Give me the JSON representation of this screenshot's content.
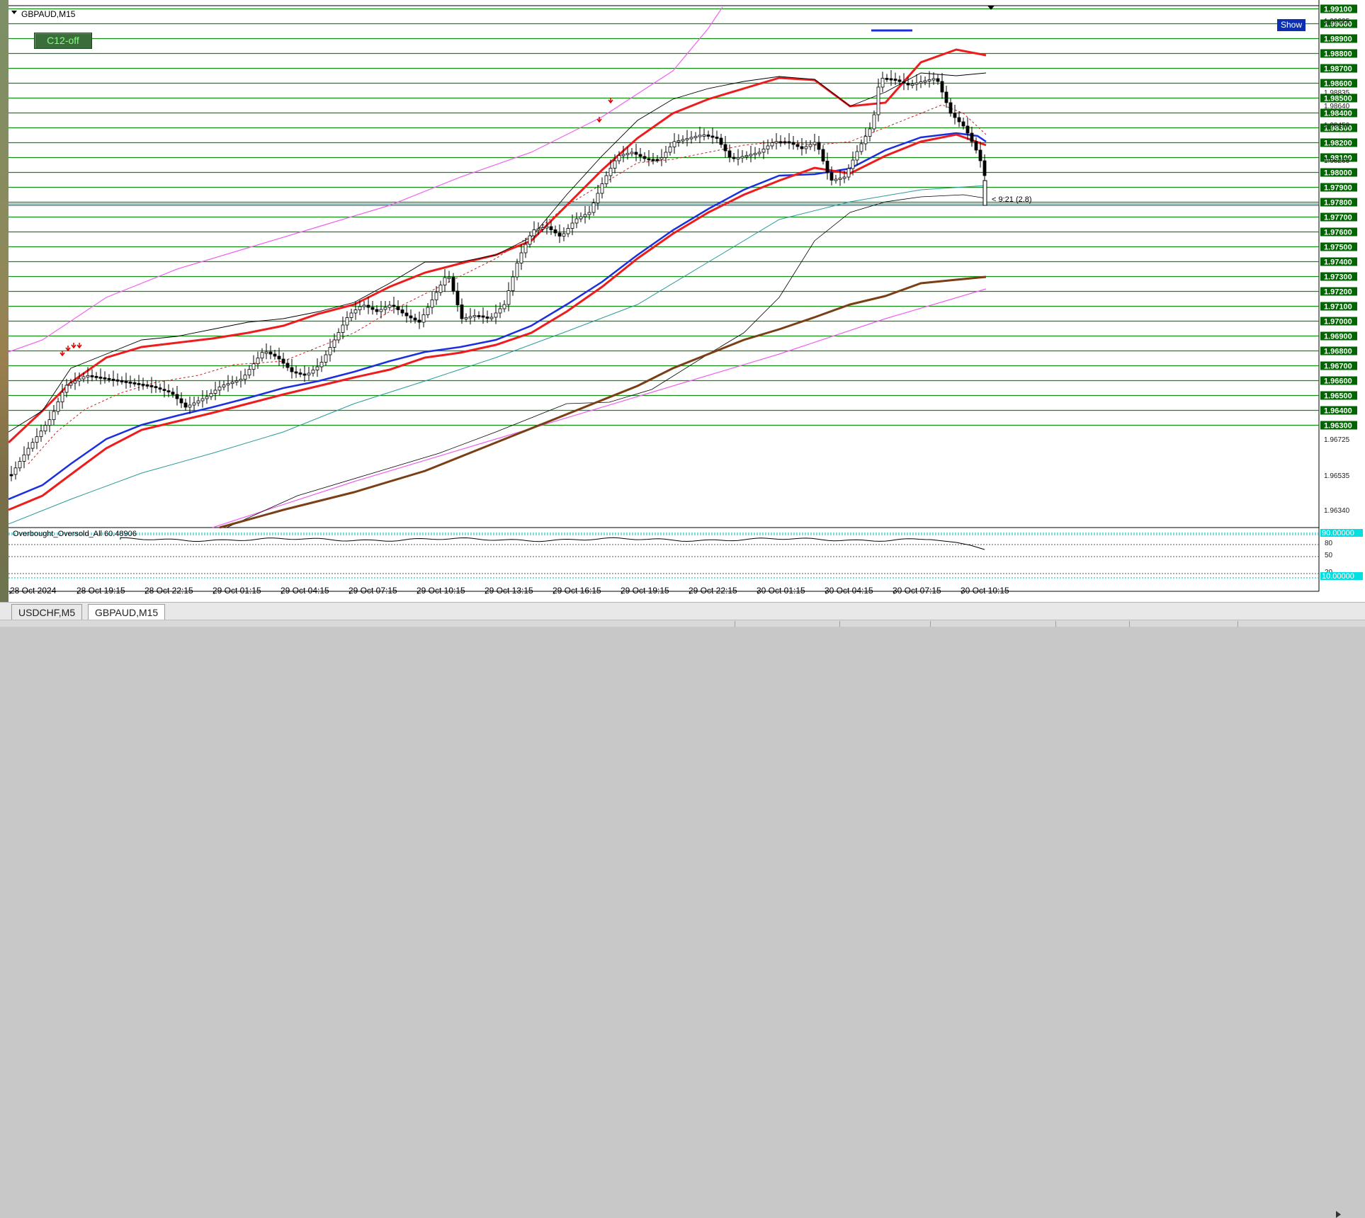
{
  "chart": {
    "symbol_label": "GBPAUD,M15",
    "indicator_button": "C12-off",
    "show_button": "Show",
    "timer_label": "< 9:21 (2.8)",
    "oscillator_label": "Overbought_Oversold_All 60.48906"
  },
  "price_axis": {
    "level_labels": [
      "1.99100",
      "1.99000",
      "1.98900",
      "1.98800",
      "1.98700",
      "1.98600",
      "1.98500",
      "1.98400",
      "1.98300",
      "1.98200",
      "1.98100",
      "1.98000",
      "1.97900",
      "1.97800",
      "1.97700",
      "1.97600",
      "1.97500",
      "1.97400",
      "1.97300",
      "1.97200",
      "1.97100",
      "1.97000",
      "1.96900",
      "1.96800",
      "1.96700",
      "1.96600",
      "1.96500",
      "1.96400",
      "1.96300"
    ],
    "minor_labels": [
      "1.99025",
      "1.98835",
      "1.98640",
      "1.98450",
      "1.98260",
      "1.96725",
      "1.96535",
      "1.96340"
    ],
    "oscillator_labels": [
      "90.00000",
      "80",
      "50",
      "20",
      "10.00000"
    ]
  },
  "time_axis": {
    "labels": [
      "28 Oct 2024",
      "28 Oct 19:15",
      "28 Oct 22:15",
      "29 Oct 01:15",
      "29 Oct 04:15",
      "29 Oct 07:15",
      "29 Oct 10:15",
      "29 Oct 13:15",
      "29 Oct 16:15",
      "29 Oct 19:15",
      "29 Oct 22:15",
      "30 Oct 01:15",
      "30 Oct 04:15",
      "30 Oct 07:15",
      "30 Oct 10:15"
    ]
  },
  "tabs": [
    {
      "label": "USDCHF,M5",
      "active": false
    },
    {
      "label": "GBPAUD,M15",
      "active": true
    }
  ],
  "colors": {
    "level_line": "#138a13",
    "level_label_bg": "#006400",
    "ma_red": "#ee1c1c",
    "ma_blue": "#1a2fe0",
    "ma_brown": "#7a3f14",
    "envelope_magenta": "#f060f0",
    "ma_teal": "#2a9a9a",
    "show_button": "#0b2fb3",
    "indicator_button": "#3a6d3a"
  }
}
